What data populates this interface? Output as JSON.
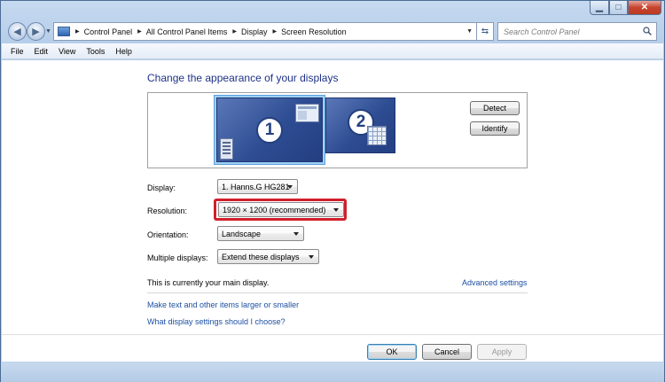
{
  "window": {
    "minimize_glyph": "▁",
    "maximize_glyph": "□",
    "close_glyph": "✕"
  },
  "nav": {
    "back_glyph": "◀",
    "forward_glyph": "▶",
    "breadcrumbs": [
      "Control Panel",
      "All Control Panel Items",
      "Display",
      "Screen Resolution"
    ],
    "refresh_glyph": "⇆",
    "search_placeholder": "Search Control Panel"
  },
  "menu": {
    "items": [
      "File",
      "Edit",
      "View",
      "Tools",
      "Help"
    ]
  },
  "page": {
    "title": "Change the appearance of your displays",
    "monitors": [
      {
        "number": "1",
        "selected": true
      },
      {
        "number": "2",
        "selected": false
      }
    ],
    "detect_label": "Detect",
    "identify_label": "Identify",
    "display": {
      "label": "Display:",
      "value": "1. Hanns.G HG281"
    },
    "resolution": {
      "label": "Resolution:",
      "value": "1920 × 1200 (recommended)"
    },
    "orientation": {
      "label": "Orientation:",
      "value": "Landscape"
    },
    "multiple_displays": {
      "label": "Multiple displays:",
      "value": "Extend these displays"
    },
    "main_display_note": "This is currently your main display.",
    "advanced_settings_link": "Advanced settings",
    "links": [
      "Make text and other items larger or smaller",
      "What display settings should I choose?"
    ]
  },
  "footer": {
    "ok_label": "OK",
    "cancel_label": "Cancel",
    "apply_label": "Apply"
  },
  "colors": {
    "link": "#1c4fa3",
    "title": "#1e3287",
    "highlight": "#d11f2b",
    "monitor": "#2e4c92"
  }
}
